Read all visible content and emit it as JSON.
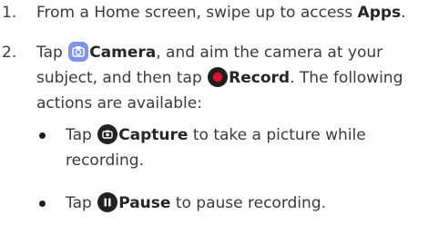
{
  "steps": [
    {
      "number": "1.",
      "parts": [
        "From a Home screen, swipe up to access ",
        "Apps",
        "."
      ]
    },
    {
      "number": "2.",
      "t1": "Tap ",
      "camera_label": "Camera",
      "t2": ", and aim the camera at your",
      "line2_a": "subject, and then tap ",
      "record_label": "Record",
      "line2_b": ". The following",
      "line3": "actions are available:"
    }
  ],
  "bullets": [
    {
      "t1": "Tap ",
      "label": "Capture",
      "line1_rest": " to take a picture while",
      "line2": "recording.",
      "icon": "capture-camera-icon"
    },
    {
      "t1": "Tap ",
      "label": "Pause",
      "rest": " to pause recording.",
      "icon": "pause-icon"
    }
  ],
  "colors": {
    "camera_icon": "#6f8cf2",
    "record_icon": "#e3102b",
    "capture_icon": "#222222",
    "pause_icon": "#222222",
    "text": "#3a3a3a"
  }
}
